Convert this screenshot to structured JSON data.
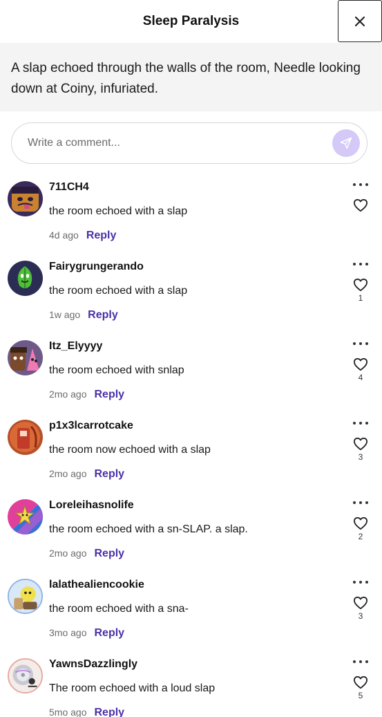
{
  "header": {
    "title": "Sleep Paralysis"
  },
  "quote": "A slap echoed through the walls of the room, Needle looking down at Coiny, infuriated.",
  "comment_box": {
    "placeholder": "Write a comment..."
  },
  "reply_label": "Reply",
  "comments": [
    {
      "user": "711CH4",
      "text": "the room echoed with a slap",
      "time": "4d ago",
      "likes": ""
    },
    {
      "user": "Fairygrungerando",
      "text": "the room echoed with a slap",
      "time": "1w ago",
      "likes": "1"
    },
    {
      "user": "Itz_Elyyyy",
      "text": "the room echoed with snlap",
      "time": "2mo ago",
      "likes": "4"
    },
    {
      "user": "p1x3lcarrotcake",
      "text": "the room now echoed with a slap",
      "time": "2mo ago",
      "likes": "3"
    },
    {
      "user": "Loreleihasnolife",
      "text": "the room echoed with a sn-SLAP. a slap.",
      "time": "2mo ago",
      "likes": "2"
    },
    {
      "user": "lalathealiencookie",
      "text": "the room echoed with a sna-",
      "time": "3mo ago",
      "likes": "3"
    },
    {
      "user": "YawnsDazzlingly",
      "text": "The room echoed with a loud slap",
      "time": "5mo ago",
      "likes": "5"
    }
  ],
  "colors": {
    "accent": "#4a2fa8",
    "send_button": "#d4c9f7",
    "quote_bg": "#f4f4f4"
  },
  "icons": {
    "close": "close-icon",
    "send": "send-icon",
    "more": "more-icon",
    "like": "heart-icon"
  }
}
